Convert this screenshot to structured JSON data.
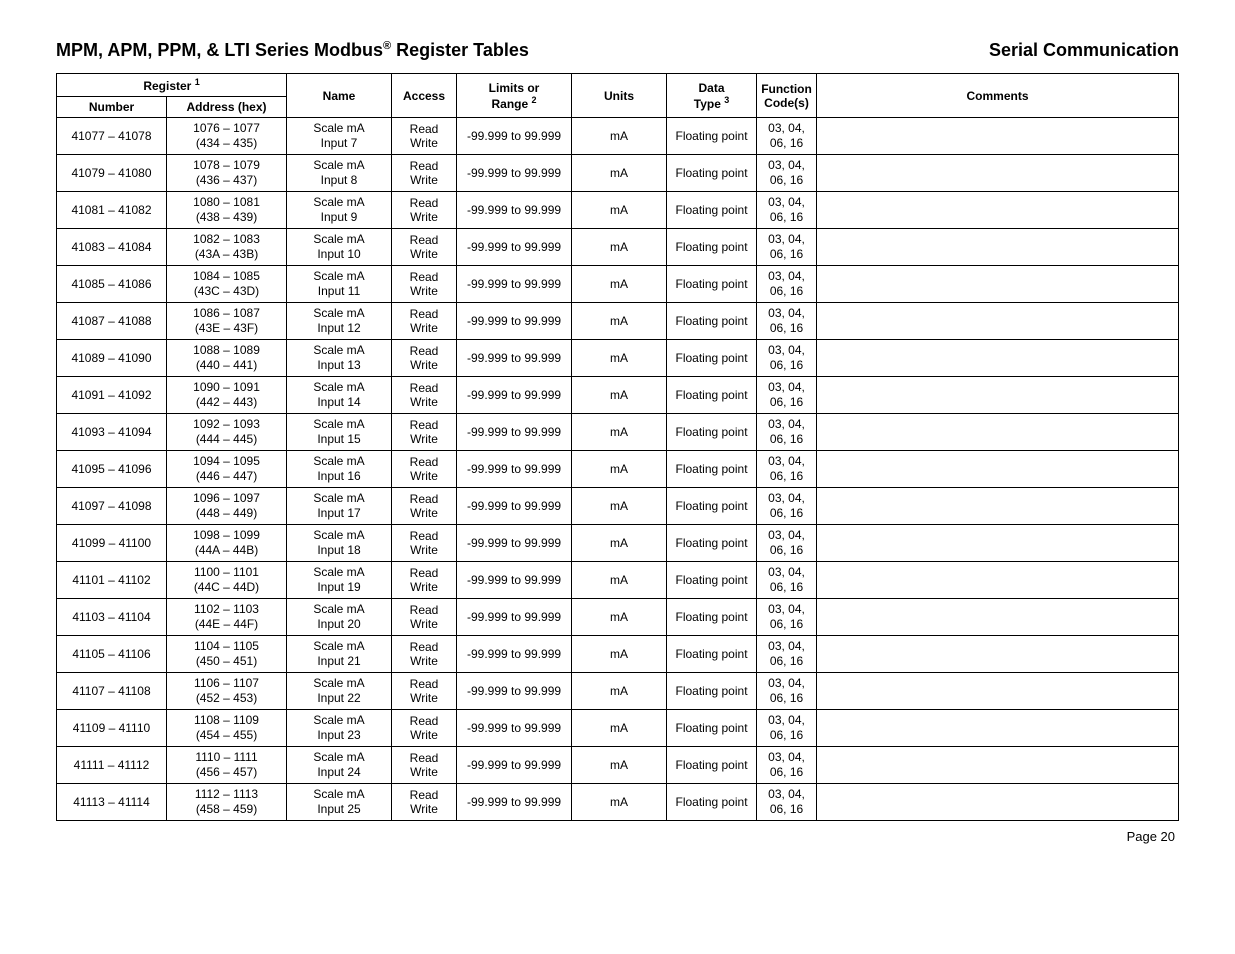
{
  "header": {
    "title_left_a": "MPM, APM, PPM, & LTI Series Modbus",
    "title_left_sup": "®",
    "title_left_b": " Register Tables",
    "title_right": "Serial Communication"
  },
  "columns": {
    "register": "Register",
    "register_sup": "1",
    "number": "Number",
    "address": "Address (hex)",
    "name": "Name",
    "access": "Access",
    "limits_a": "Limits or",
    "limits_b": "Range",
    "limits_sup": "2",
    "units": "Units",
    "data_a": "Data",
    "data_b": "Type",
    "data_sup": "3",
    "function_a": "Function",
    "function_b": "Code(s)",
    "comments": "Comments"
  },
  "rows": [
    {
      "number": "41077 – 41078",
      "addr_a": "1076 – 1077",
      "addr_b": "(434 – 435)",
      "name_a": "Scale mA",
      "name_b": "Input 7",
      "access": "Read Write",
      "limits": "-99.999 to 99.999",
      "units": "mA",
      "dtype": "Floating point",
      "func_a": "03, 04,",
      "func_b": "06, 16",
      "comments": ""
    },
    {
      "number": "41079 – 41080",
      "addr_a": "1078 – 1079",
      "addr_b": "(436 – 437)",
      "name_a": "Scale mA",
      "name_b": "Input 8",
      "access": "Read Write",
      "limits": "-99.999 to 99.999",
      "units": "mA",
      "dtype": "Floating point",
      "func_a": "03, 04,",
      "func_b": "06, 16",
      "comments": ""
    },
    {
      "number": "41081 – 41082",
      "addr_a": "1080 – 1081",
      "addr_b": "(438 – 439)",
      "name_a": "Scale mA",
      "name_b": "Input 9",
      "access": "Read Write",
      "limits": "-99.999 to 99.999",
      "units": "mA",
      "dtype": "Floating point",
      "func_a": "03, 04,",
      "func_b": "06, 16",
      "comments": ""
    },
    {
      "number": "41083 – 41084",
      "addr_a": "1082 – 1083",
      "addr_b": "(43A – 43B)",
      "name_a": "Scale mA",
      "name_b": "Input 10",
      "access": "Read Write",
      "limits": "-99.999 to 99.999",
      "units": "mA",
      "dtype": "Floating point",
      "func_a": "03, 04,",
      "func_b": "06, 16",
      "comments": ""
    },
    {
      "number": "41085 – 41086",
      "addr_a": "1084 – 1085",
      "addr_b": "(43C – 43D)",
      "name_a": "Scale mA",
      "name_b": "Input 11",
      "access": "Read Write",
      "limits": "-99.999 to 99.999",
      "units": "mA",
      "dtype": "Floating point",
      "func_a": "03, 04,",
      "func_b": "06, 16",
      "comments": ""
    },
    {
      "number": "41087 – 41088",
      "addr_a": "1086 – 1087",
      "addr_b": "(43E – 43F)",
      "name_a": "Scale mA",
      "name_b": "Input 12",
      "access": "Read Write",
      "limits": "-99.999 to 99.999",
      "units": "mA",
      "dtype": "Floating point",
      "func_a": "03, 04,",
      "func_b": "06, 16",
      "comments": ""
    },
    {
      "number": "41089 – 41090",
      "addr_a": "1088 – 1089",
      "addr_b": "(440 – 441)",
      "name_a": "Scale mA",
      "name_b": "Input 13",
      "access": "Read Write",
      "limits": "-99.999 to 99.999",
      "units": "mA",
      "dtype": "Floating point",
      "func_a": "03, 04,",
      "func_b": "06, 16",
      "comments": ""
    },
    {
      "number": "41091 – 41092",
      "addr_a": "1090 – 1091",
      "addr_b": "(442 – 443)",
      "name_a": "Scale mA",
      "name_b": "Input 14",
      "access": "Read Write",
      "limits": "-99.999 to 99.999",
      "units": "mA",
      "dtype": "Floating point",
      "func_a": "03, 04,",
      "func_b": "06, 16",
      "comments": ""
    },
    {
      "number": "41093 – 41094",
      "addr_a": "1092 – 1093",
      "addr_b": "(444 – 445)",
      "name_a": "Scale mA",
      "name_b": "Input 15",
      "access": "Read Write",
      "limits": "-99.999 to 99.999",
      "units": "mA",
      "dtype": "Floating point",
      "func_a": "03, 04,",
      "func_b": "06, 16",
      "comments": ""
    },
    {
      "number": "41095 – 41096",
      "addr_a": "1094 – 1095",
      "addr_b": "(446 – 447)",
      "name_a": "Scale mA",
      "name_b": "Input 16",
      "access": "Read Write",
      "limits": "-99.999 to 99.999",
      "units": "mA",
      "dtype": "Floating point",
      "func_a": "03, 04,",
      "func_b": "06, 16",
      "comments": ""
    },
    {
      "number": "41097 – 41098",
      "addr_a": "1096 – 1097",
      "addr_b": "(448 – 449)",
      "name_a": "Scale mA",
      "name_b": "Input 17",
      "access": "Read Write",
      "limits": "-99.999 to 99.999",
      "units": "mA",
      "dtype": "Floating point",
      "func_a": "03, 04,",
      "func_b": "06, 16",
      "comments": ""
    },
    {
      "number": "41099 – 41100",
      "addr_a": "1098 – 1099",
      "addr_b": "(44A – 44B)",
      "name_a": "Scale mA",
      "name_b": "Input 18",
      "access": "Read Write",
      "limits": "-99.999 to 99.999",
      "units": "mA",
      "dtype": "Floating point",
      "func_a": "03, 04,",
      "func_b": "06, 16",
      "comments": ""
    },
    {
      "number": "41101 – 41102",
      "addr_a": "1100 – 1101",
      "addr_b": "(44C – 44D)",
      "name_a": "Scale mA",
      "name_b": "Input 19",
      "access": "Read Write",
      "limits": "-99.999 to 99.999",
      "units": "mA",
      "dtype": "Floating point",
      "func_a": "03, 04,",
      "func_b": "06, 16",
      "comments": ""
    },
    {
      "number": "41103 – 41104",
      "addr_a": "1102 – 1103",
      "addr_b": "(44E – 44F)",
      "name_a": "Scale mA",
      "name_b": "Input 20",
      "access": "Read Write",
      "limits": "-99.999 to 99.999",
      "units": "mA",
      "dtype": "Floating point",
      "func_a": "03, 04,",
      "func_b": "06, 16",
      "comments": ""
    },
    {
      "number": "41105 – 41106",
      "addr_a": "1104 – 1105",
      "addr_b": "(450 – 451)",
      "name_a": "Scale mA",
      "name_b": "Input 21",
      "access": "Read Write",
      "limits": "-99.999 to 99.999",
      "units": "mA",
      "dtype": "Floating point",
      "func_a": "03, 04,",
      "func_b": "06, 16",
      "comments": ""
    },
    {
      "number": "41107 – 41108",
      "addr_a": "1106 – 1107",
      "addr_b": "(452 – 453)",
      "name_a": "Scale mA",
      "name_b": "Input 22",
      "access": "Read Write",
      "limits": "-99.999 to 99.999",
      "units": "mA",
      "dtype": "Floating point",
      "func_a": "03, 04,",
      "func_b": "06, 16",
      "comments": ""
    },
    {
      "number": "41109 – 41110",
      "addr_a": "1108 – 1109",
      "addr_b": "(454 – 455)",
      "name_a": "Scale mA",
      "name_b": "Input 23",
      "access": "Read Write",
      "limits": "-99.999 to 99.999",
      "units": "mA",
      "dtype": "Floating point",
      "func_a": "03, 04,",
      "func_b": "06, 16",
      "comments": ""
    },
    {
      "number": "41111 – 41112",
      "addr_a": "1110 – 1111",
      "addr_b": "(456 – 457)",
      "name_a": "Scale mA",
      "name_b": "Input 24",
      "access": "Read Write",
      "limits": "-99.999 to 99.999",
      "units": "mA",
      "dtype": "Floating point",
      "func_a": "03, 04,",
      "func_b": "06, 16",
      "comments": ""
    },
    {
      "number": "41113 – 41114",
      "addr_a": "1112 – 1113",
      "addr_b": "(458 – 459)",
      "name_a": "Scale mA",
      "name_b": "Input 25",
      "access": "Read Write",
      "limits": "-99.999 to 99.999",
      "units": "mA",
      "dtype": "Floating point",
      "func_a": "03, 04,",
      "func_b": "06, 16",
      "comments": ""
    }
  ],
  "footer": {
    "page": "Page 20"
  }
}
